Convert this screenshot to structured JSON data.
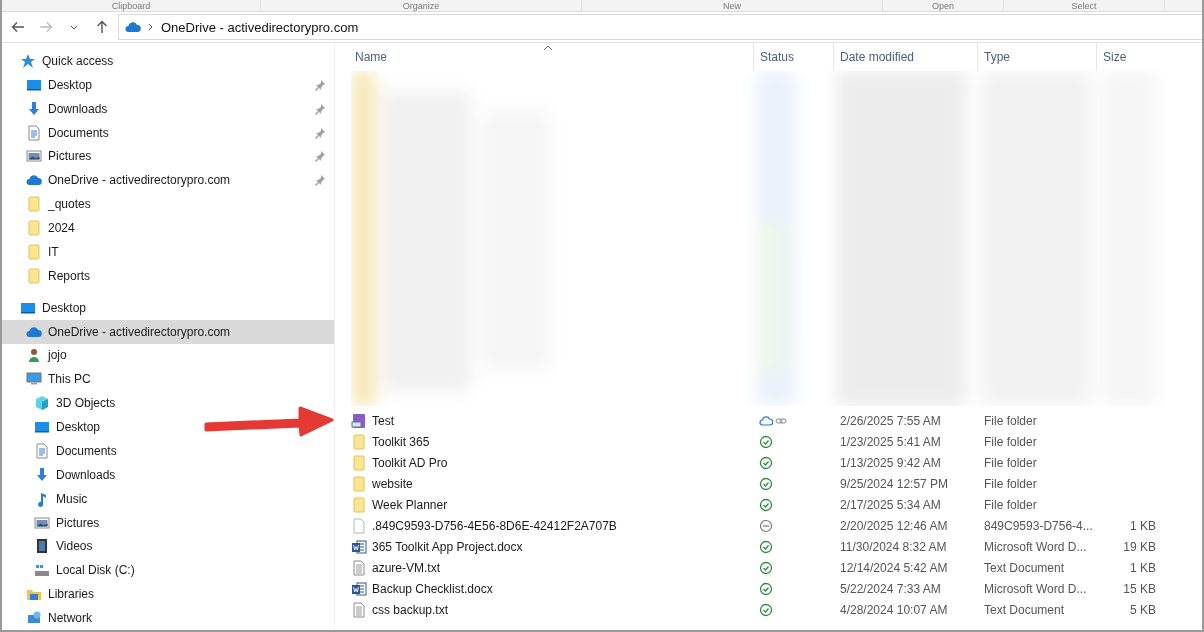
{
  "ribbon": {
    "groups": [
      "Clipboard",
      "Organize",
      "New",
      "Open",
      "Select"
    ]
  },
  "address_bar": {
    "path": "OneDrive - activedirectorypro.com"
  },
  "sidebar": {
    "items": [
      {
        "label": "Quick access",
        "kind": "star",
        "selected": false,
        "children": [
          {
            "label": "Desktop",
            "kind": "desktop",
            "pinned": true,
            "selected": false
          },
          {
            "label": "Downloads",
            "kind": "download",
            "pinned": true,
            "selected": false
          },
          {
            "label": "Documents",
            "kind": "document",
            "pinned": true,
            "selected": false
          },
          {
            "label": "Pictures",
            "kind": "pictures",
            "pinned": true,
            "selected": false
          },
          {
            "label": "OneDrive - activedirectorypro.com",
            "kind": "cloud",
            "pinned": true,
            "selected": false
          },
          {
            "label": "_quotes",
            "kind": "folder",
            "pinned": false,
            "selected": false
          },
          {
            "label": "2024",
            "kind": "folder",
            "pinned": false,
            "selected": false
          },
          {
            "label": "IT",
            "kind": "folder",
            "pinned": false,
            "selected": false
          },
          {
            "label": "Reports",
            "kind": "folder",
            "pinned": false,
            "selected": false
          }
        ]
      },
      {
        "label": "Desktop",
        "kind": "desktop",
        "selected": false,
        "children": [
          {
            "label": "OneDrive - activedirectorypro.com",
            "kind": "cloud",
            "selected": true
          },
          {
            "label": "jojo",
            "kind": "user",
            "selected": false
          },
          {
            "label": "This PC",
            "kind": "pc",
            "selected": false,
            "children": [
              {
                "label": "3D Objects",
                "kind": "cube",
                "selected": false
              },
              {
                "label": "Desktop",
                "kind": "desktop",
                "selected": false
              },
              {
                "label": "Documents",
                "kind": "document",
                "selected": false
              },
              {
                "label": "Downloads",
                "kind": "download",
                "selected": false
              },
              {
                "label": "Music",
                "kind": "music",
                "selected": false
              },
              {
                "label": "Pictures",
                "kind": "pictures",
                "selected": false
              },
              {
                "label": "Videos",
                "kind": "video",
                "selected": false
              },
              {
                "label": "Local Disk (C:)",
                "kind": "disk",
                "selected": false
              }
            ]
          },
          {
            "label": "Libraries",
            "kind": "library",
            "selected": false
          },
          {
            "label": "Network",
            "kind": "network",
            "selected": false
          }
        ]
      }
    ]
  },
  "table": {
    "columns": [
      "Name",
      "Status",
      "Date modified",
      "Type",
      "Size"
    ],
    "rows": [
      {
        "kind": "linked-folder",
        "name": "Test",
        "status": {
          "kind": "cloud-shared"
        },
        "date": "2/26/2025 7:55 AM",
        "type": "File folder"
      },
      {
        "kind": "folder",
        "name": "Toolkit 365",
        "status": {
          "kind": "synced"
        },
        "date": "1/23/2025 5:41 AM",
        "type": "File folder"
      },
      {
        "kind": "folder",
        "name": "Toolkit AD Pro",
        "status": {
          "kind": "synced"
        },
        "date": "1/13/2025 9:42 AM",
        "type": "File folder"
      },
      {
        "kind": "folder",
        "name": "website",
        "status": {
          "kind": "synced"
        },
        "date": "9/25/2024 12:57 PM",
        "type": "File folder"
      },
      {
        "kind": "folder",
        "name": "Week Planner",
        "status": {
          "kind": "synced"
        },
        "date": "2/17/2025 5:34 AM",
        "type": "File folder"
      },
      {
        "kind": "blank",
        "name": ".849C9593-D756-4E56-8D6E-42412F2A707B",
        "status": {
          "kind": "excluded"
        },
        "date": "2/20/2025 12:46 AM",
        "type": "849C9593-D756-4...",
        "size": "1 KB"
      },
      {
        "kind": "word",
        "name": "365 Toolkit App Project.docx",
        "status": {
          "kind": "synced"
        },
        "date": "11/30/2024 8:32 AM",
        "type": "Microsoft Word D...",
        "size": "19 KB"
      },
      {
        "kind": "text",
        "name": "azure-VM.txt",
        "status": {
          "kind": "synced"
        },
        "date": "12/14/2024 5:42 AM",
        "type": "Text Document",
        "size": "1 KB"
      },
      {
        "kind": "word",
        "name": "Backup Checklist.docx",
        "status": {
          "kind": "synced"
        },
        "date": "5/22/2024 7:33 AM",
        "type": "Microsoft Word D...",
        "size": "15 KB"
      },
      {
        "kind": "text",
        "name": "css backup.txt",
        "status": {
          "kind": "synced"
        },
        "date": "4/28/2024 10:07 AM",
        "type": "Text Document",
        "size": "5 KB"
      }
    ]
  },
  "annotation": {
    "kind": "arrow"
  }
}
